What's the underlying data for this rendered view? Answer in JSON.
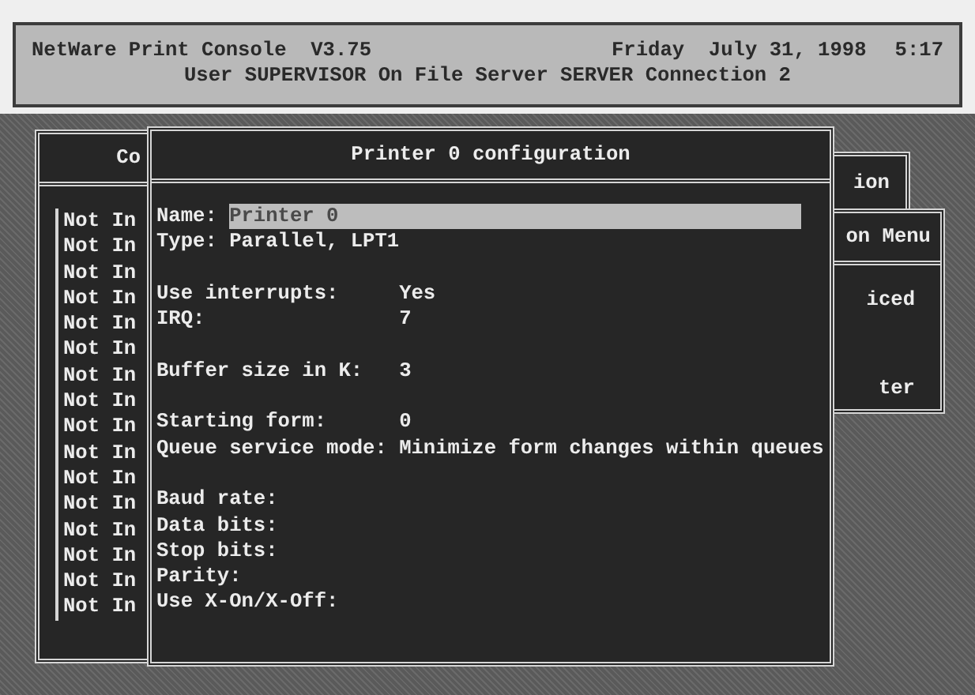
{
  "header": {
    "program": "NetWare Print Console  V3.75",
    "date": "Friday  July 31, 1998",
    "time": "5:17",
    "user_line": "User SUPERVISOR On File Server SERVER Connection 2"
  },
  "back_windows": [
    {
      "title": "ion"
    },
    {
      "title": "on Menu",
      "items": [
        "iced",
        "ter"
      ]
    }
  ],
  "list_window": {
    "title": "Co",
    "items": [
      "Not In",
      "Not In",
      "Not In",
      "Not In",
      "Not In",
      "Not In",
      "Not In",
      "Not In",
      "Not In",
      "Not In",
      "Not In",
      "Not In",
      "Not In",
      "Not In",
      "Not In",
      "Not In"
    ]
  },
  "config_window": {
    "title": "Printer 0 configuration",
    "groups": [
      [
        {
          "label": "Name:",
          "value": "Printer 0",
          "kind": "inline",
          "selected": true
        },
        {
          "label": "Type:",
          "value": "Parallel, LPT1",
          "kind": "inline",
          "selected": false
        }
      ],
      [
        {
          "label": "Use interrupts:",
          "value": "Yes",
          "kind": "column",
          "selected": false
        },
        {
          "label": "IRQ:",
          "value": "7",
          "kind": "column",
          "selected": false
        }
      ],
      [
        {
          "label": "Buffer size in K:",
          "value": "3",
          "kind": "column",
          "selected": false
        }
      ],
      [
        {
          "label": "Starting form:",
          "value": "0",
          "kind": "column",
          "selected": false
        },
        {
          "label": "Queue service mode:",
          "value": "Minimize form changes within queues",
          "kind": "column",
          "selected": false
        }
      ],
      [
        {
          "label": "Baud rate:",
          "kind": "column",
          "selected": false
        },
        {
          "label": "Data bits:",
          "kind": "column",
          "selected": false
        },
        {
          "label": "Stop bits:",
          "kind": "column",
          "selected": false
        },
        {
          "label": "Parity:",
          "kind": "column",
          "selected": false
        },
        {
          "label": "Use X-On/X-Off:",
          "kind": "column",
          "selected": false
        }
      ]
    ]
  }
}
